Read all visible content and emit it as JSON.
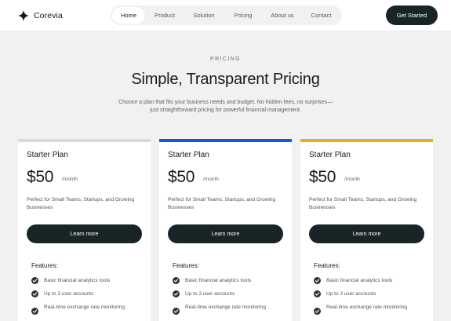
{
  "brand": {
    "name": "Corevia",
    "logo_icon": "plus-star-icon"
  },
  "nav": {
    "items": [
      {
        "label": "Home",
        "active": true
      },
      {
        "label": "Product",
        "active": false
      },
      {
        "label": "Solution",
        "active": false
      },
      {
        "label": "Pricing",
        "active": false
      },
      {
        "label": "About us",
        "active": false
      },
      {
        "label": "Contact",
        "active": false
      }
    ],
    "cta_label": "Get Started"
  },
  "hero": {
    "eyebrow": "PRICING",
    "title": "Simple, Transparent Pricing",
    "subtitle": "Choose a plan that fits your business needs and budget. No hidden fees, no surprises—just straightforward pricing for powerful financial management."
  },
  "colors": {
    "primary_dark": "#192426",
    "page_bg": "#f1f1f0",
    "card_accent_1": "#d9d9d9",
    "card_accent_2": "#1356e8",
    "card_accent_3": "#f5a623"
  },
  "plans": [
    {
      "name": "Starter Plan",
      "price": "$50",
      "period": "/month",
      "description": "Perfect for Small Teams, Startups, and Growing Businesses",
      "button_label": "Learn more",
      "features_title": "Features:",
      "features": [
        "Basic financial analytics tools",
        "Up to 3 user accounts",
        "Real-time exchange rate monitoring"
      ]
    },
    {
      "name": "Starter Plan",
      "price": "$50",
      "period": "/month",
      "description": "Perfect for Small Teams, Startups, and Growing Businesses",
      "button_label": "Learn more",
      "features_title": "Features:",
      "features": [
        "Basic financial analytics tools",
        "Up to 3 user accounts",
        "Real-time exchange rate monitoring"
      ]
    },
    {
      "name": "Starter Plan",
      "price": "$50",
      "period": "/month",
      "description": "Perfect for Small Teams, Startups, and Growing Businesses",
      "button_label": "Learn more",
      "features_title": "Features:",
      "features": [
        "Basic financial analytics tools",
        "Up to 3 user accounts",
        "Real-time exchange rate monitoring"
      ]
    }
  ]
}
